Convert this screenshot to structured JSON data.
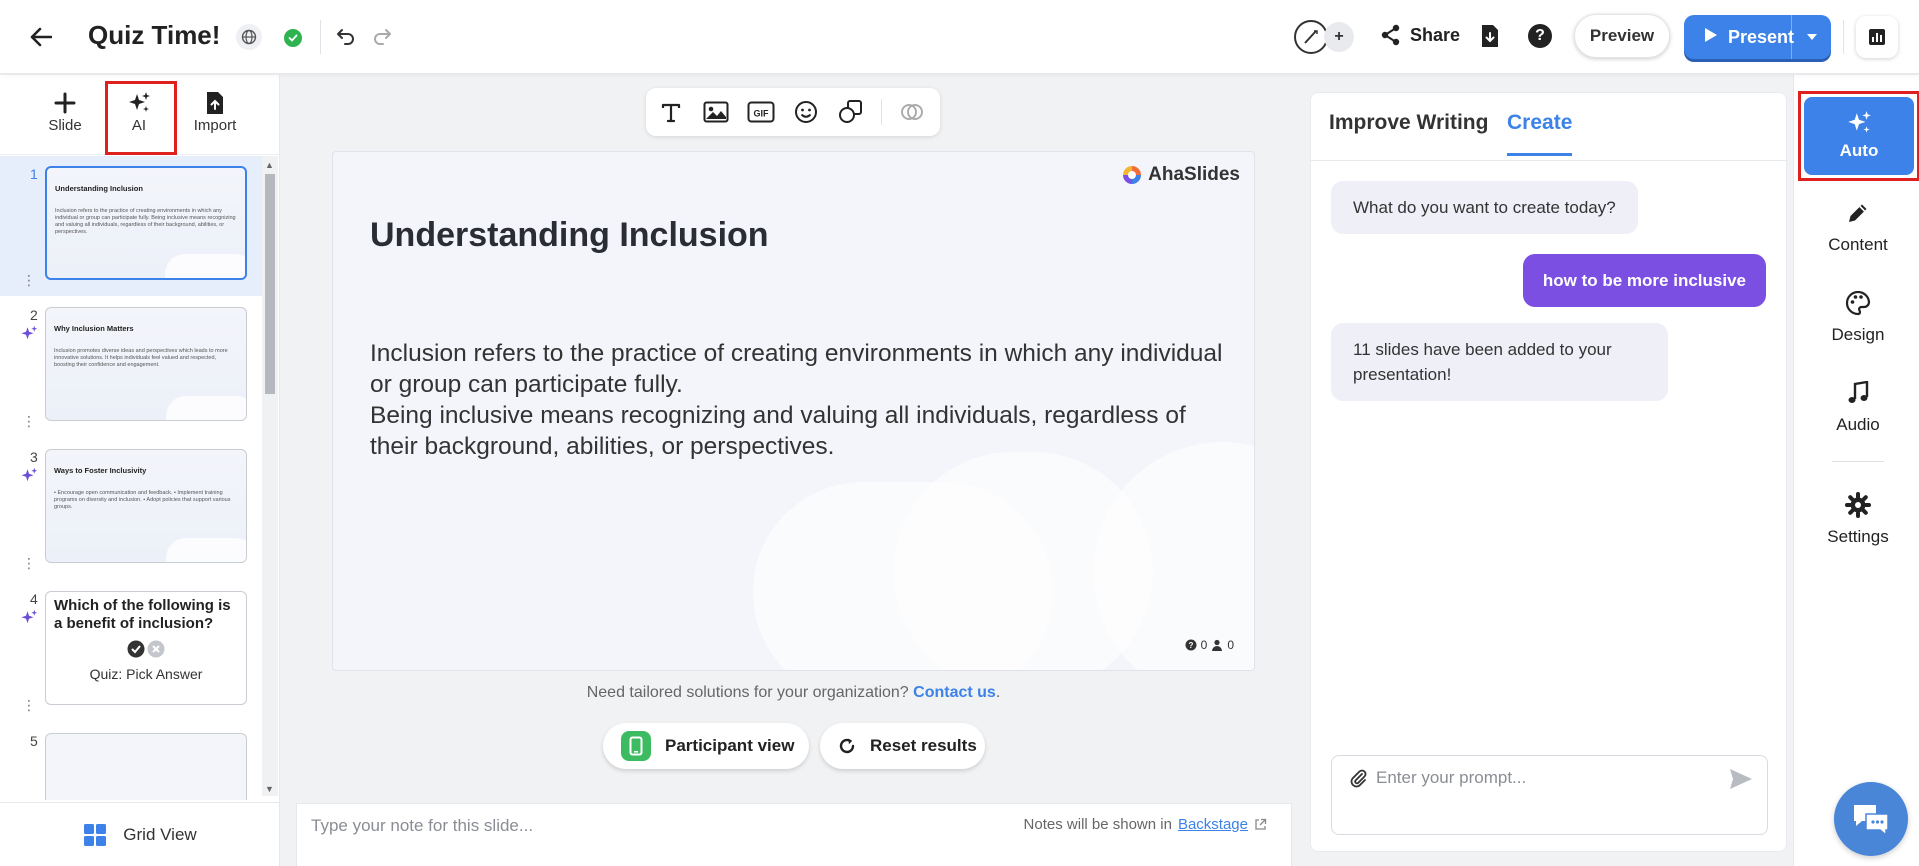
{
  "header": {
    "title": "Quiz Time!",
    "share_label": "Share",
    "preview_label": "Preview",
    "present_label": "Present",
    "avatar_plus": "+",
    "help_glyph": "?"
  },
  "left_actions": {
    "slide_label": "Slide",
    "ai_label": "AI",
    "import_label": "Import"
  },
  "slides": [
    {
      "num": "1",
      "title": "Understanding Inclusion",
      "body": "Inclusion refers to the practice of creating environments in which any individual or group can participate fully. Being inclusive means recognizing and valuing all individuals, regardless of their background, abilities, or perspectives."
    },
    {
      "num": "2",
      "title": "Why Inclusion Matters",
      "body": "Inclusion promotes diverse ideas and perspectives which leads to more innovative solutions. It helps individuals feel valued and respected, boosting their confidence and engagement."
    },
    {
      "num": "3",
      "title": "Ways to Foster Inclusivity",
      "body": "• Encourage open communication and feedback. • Implement training programs on diversity and inclusion. • Adopt policies that support various groups."
    },
    {
      "num": "4",
      "title": "Which of the following is a benefit of inclusion?",
      "label": "Quiz: Pick Answer"
    },
    {
      "num": "5"
    }
  ],
  "grid_view_label": "Grid View",
  "canvas": {
    "brand": "AhaSlides",
    "title": "Understanding Inclusion",
    "body_line1": "Inclusion refers to the practice of creating environments in which any individual or group can participate fully.",
    "body_line2": "Being inclusive means recognizing and valuing all individuals, regardless of their background, abilities, or perspectives.",
    "questions_count": "0",
    "participants_count": "0"
  },
  "contact": {
    "text": "Need tailored solutions for your organization?",
    "link": "Contact us",
    "period": "."
  },
  "participant_view_label": "Participant view",
  "reset_results_label": "Reset results",
  "notes": {
    "placeholder": "Type your note for this slide...",
    "hint": "Notes will be shown in",
    "hint_link": "Backstage"
  },
  "ai_panel": {
    "tab_improve": "Improve Writing",
    "tab_create": "Create",
    "messages": [
      {
        "from": "bot",
        "text": "What do you want to create today?"
      },
      {
        "from": "user",
        "text": "how to be more inclusive"
      },
      {
        "from": "bot",
        "text": "11 slides have been added to your presentation!"
      }
    ],
    "prompt_placeholder": "Enter your prompt..."
  },
  "right_rail": {
    "auto_label": "Auto",
    "content_label": "Content",
    "design_label": "Design",
    "audio_label": "Audio",
    "settings_label": "Settings"
  },
  "colors": {
    "accent": "#3c82e8",
    "user_bubble": "#7b4fe2",
    "highlight": "#e0201f",
    "success": "#2fb350"
  }
}
